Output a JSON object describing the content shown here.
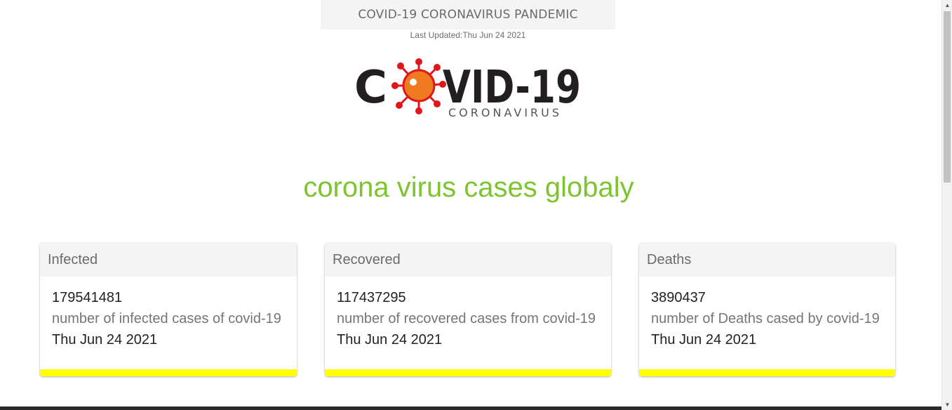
{
  "header": {
    "title": "COVID-19 CORONAVIRUS PANDEMIC",
    "last_updated": "Last Updated:Thu Jun 24 2021"
  },
  "logo": {
    "word_left": "C",
    "word_right": "VID-19",
    "subtitle": "CORONAVIRUS",
    "colors": {
      "dark": "#231f20",
      "red": "#e0161b",
      "orange": "#f07a20"
    }
  },
  "headline": "corona virus cases globaly",
  "cards": [
    {
      "title": "Infected",
      "count": "179541481",
      "description": "number of infected cases of covid-19",
      "date": "Thu Jun 24 2021"
    },
    {
      "title": "Recovered",
      "count": "117437295",
      "description": "number of recovered cases from covid-19",
      "date": "Thu Jun 24 2021"
    },
    {
      "title": "Deaths",
      "count": "3890437",
      "description": "number of Deaths cased by covid-19",
      "date": "Thu Jun 24 2021"
    }
  ],
  "colors": {
    "accent_green": "#7cc52f",
    "card_bar": "#ffff00",
    "header_bg": "#f4f4f4"
  },
  "scrollbar": {
    "up_icon": "triangle-up-icon",
    "down_icon": "triangle-down-icon"
  }
}
